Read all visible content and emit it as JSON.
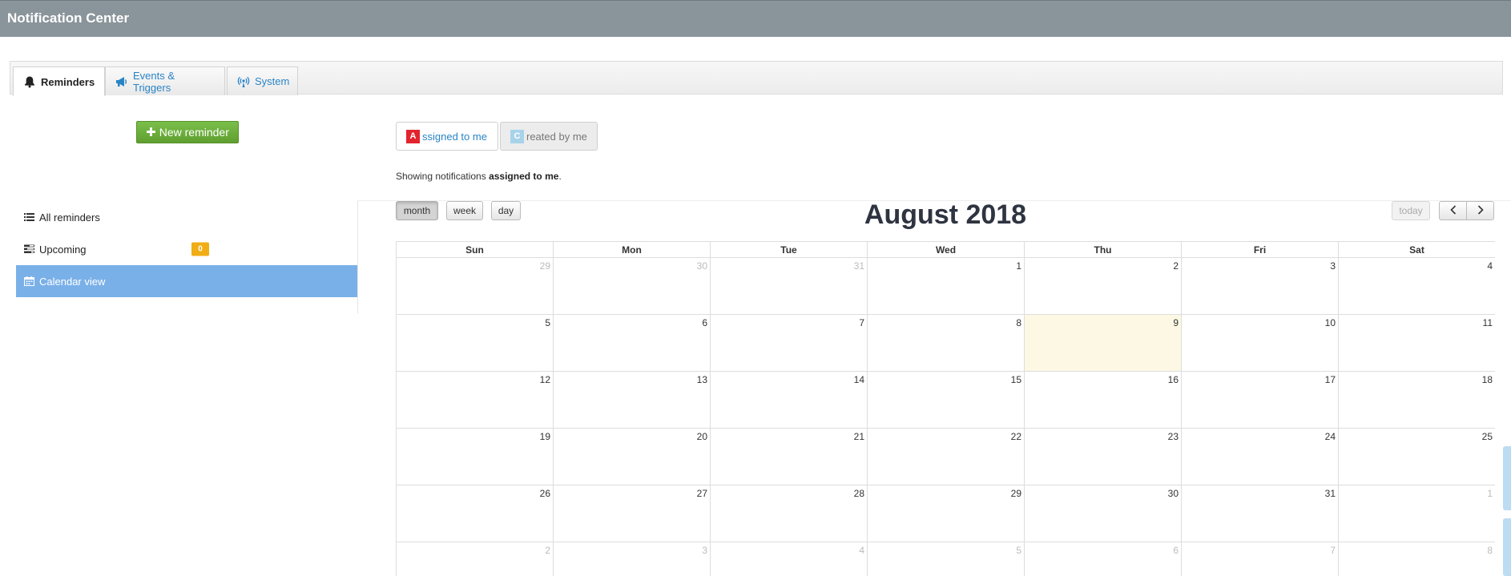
{
  "header": {
    "title": "Notification Center"
  },
  "tabs": [
    {
      "label": "Reminders",
      "icon": "bell-icon",
      "active": true
    },
    {
      "label": "Events & Triggers",
      "icon": "megaphone-icon",
      "active": false
    },
    {
      "label": "System",
      "icon": "broadcast-icon",
      "active": false
    }
  ],
  "new_reminder": {
    "label": "New reminder"
  },
  "sidebar": {
    "items": [
      {
        "label": "All reminders",
        "icon": "list-icon"
      },
      {
        "label": "Upcoming",
        "icon": "tasks-icon",
        "badge": "0"
      },
      {
        "label": "Calendar view",
        "icon": "calendar-icon"
      }
    ]
  },
  "filters": {
    "assigned": {
      "letter": "A",
      "label": "ssigned to me",
      "color": "#e2242e"
    },
    "created": {
      "letter": "C",
      "label": "reated by me",
      "color": "#a7d3ea"
    }
  },
  "showing": {
    "prefix": "Showing notifications ",
    "bold": "assigned to me",
    "suffix": "."
  },
  "calendar": {
    "title": "August 2018",
    "views": [
      "month",
      "week",
      "day"
    ],
    "today_label": "today",
    "prev_icon": "chevron-left-icon",
    "next_icon": "chevron-right-icon",
    "days_of_week": [
      "Sun",
      "Mon",
      "Tue",
      "Wed",
      "Thu",
      "Fri",
      "Sat"
    ],
    "weeks": [
      [
        "29",
        "30",
        "31",
        "1",
        "2",
        "3",
        "4"
      ],
      [
        "5",
        "6",
        "7",
        "8",
        "9",
        "10",
        "11"
      ],
      [
        "12",
        "13",
        "14",
        "15",
        "16",
        "17",
        "18"
      ],
      [
        "19",
        "20",
        "21",
        "22",
        "23",
        "24",
        "25"
      ],
      [
        "26",
        "27",
        "28",
        "29",
        "30",
        "31",
        "1"
      ],
      [
        "2",
        "3",
        "4",
        "5",
        "6",
        "7",
        "8"
      ]
    ],
    "other_month": [
      [
        true,
        true,
        true,
        false,
        false,
        false,
        false
      ],
      [
        false,
        false,
        false,
        false,
        false,
        false,
        false
      ],
      [
        false,
        false,
        false,
        false,
        false,
        false,
        false
      ],
      [
        false,
        false,
        false,
        false,
        false,
        false,
        false
      ],
      [
        false,
        false,
        false,
        false,
        false,
        false,
        true
      ],
      [
        true,
        true,
        true,
        true,
        true,
        true,
        true
      ]
    ],
    "today": "9"
  },
  "colors": {
    "header_bg": "#8a959b",
    "link_blue": "#2a84c6",
    "active_side": "#7ab0e8",
    "today_bg": "#fcf8e3",
    "badge": "#f0ad16",
    "new_button": "#6aad3b"
  }
}
